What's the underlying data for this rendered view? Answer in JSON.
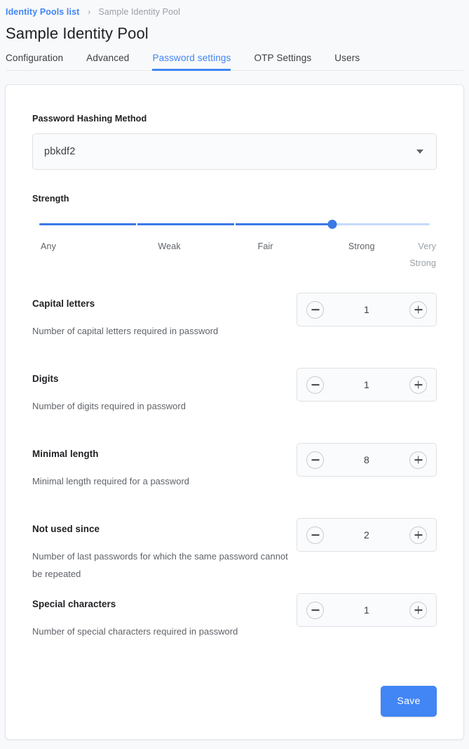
{
  "breadcrumb": {
    "link_label": "Identity Pools list",
    "separator": "›",
    "current": "Sample Identity Pool"
  },
  "header": {
    "title": "Sample Identity Pool"
  },
  "tabs": [
    {
      "label": "Configuration",
      "active": false
    },
    {
      "label": "Advanced",
      "active": false
    },
    {
      "label": "Password settings",
      "active": true
    },
    {
      "label": "OTP Settings",
      "active": false
    },
    {
      "label": "Users",
      "active": false
    }
  ],
  "hashing": {
    "label": "Password Hashing Method",
    "selected": "pbkdf2"
  },
  "strength": {
    "label": "Strength",
    "ticks": [
      "Any",
      "Weak",
      "Fair",
      "Strong",
      "Very Strong"
    ],
    "selected": "Strong",
    "selected_index": 3,
    "percent": 75
  },
  "settings": [
    {
      "name": "Capital letters",
      "description": "Number of capital letters required in password",
      "value": "1"
    },
    {
      "name": "Digits",
      "description": "Number of digits required in password",
      "value": "1"
    },
    {
      "name": "Minimal length",
      "description": "Minimal length required for a password",
      "value": "8"
    },
    {
      "name": "Not used since",
      "description": "Number of last passwords for which the same password cannot be repeated",
      "value": "2"
    },
    {
      "name": "Special characters",
      "description": "Number of special characters required in password",
      "value": "1"
    }
  ],
  "footer": {
    "save_label": "Save"
  },
  "colors": {
    "accent": "#4285f4",
    "slider_fill": "#3b78e7",
    "slider_rail": "#c6dafc",
    "page_bg": "#f8f9fb",
    "muted_text": "#5f6368"
  }
}
